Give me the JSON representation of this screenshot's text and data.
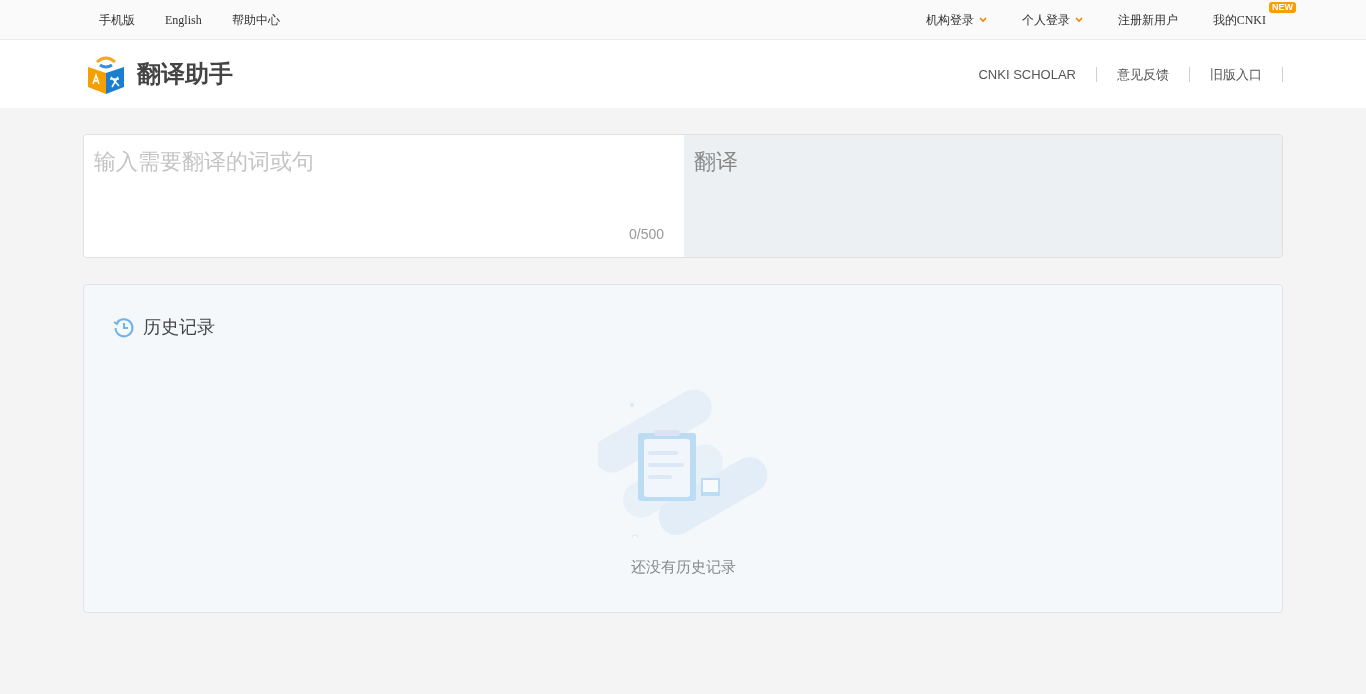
{
  "top_bar": {
    "left_links": [
      "手机版",
      "English",
      "帮助中心"
    ],
    "right_links": [
      {
        "label": "机构登录",
        "dropdown": true
      },
      {
        "label": "个人登录",
        "dropdown": true
      },
      {
        "label": "注册新用户",
        "dropdown": false
      },
      {
        "label": "我的CNKI",
        "dropdown": false,
        "badge": "NEW"
      }
    ]
  },
  "header": {
    "title": "翻译助手",
    "nav": [
      "CNKI SCHOLAR",
      "意见反馈",
      "旧版入口"
    ]
  },
  "translator": {
    "input": {
      "placeholder": "输入需要翻译的词或句",
      "counter": "0/500"
    },
    "output": {
      "placeholder": "翻译"
    }
  },
  "history": {
    "title": "历史记录",
    "empty_text": "还没有历史记录"
  }
}
